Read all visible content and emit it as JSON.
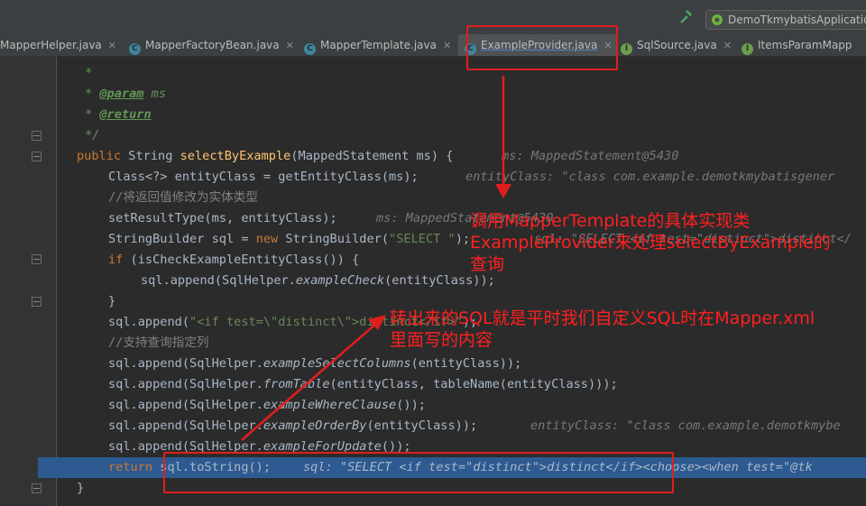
{
  "run_config": "DemoTkmybatisApplication",
  "tabs": [
    {
      "label": "MapperHelper.java",
      "icon": "",
      "active": false
    },
    {
      "label": "MapperFactoryBean.java",
      "icon": "C",
      "active": false
    },
    {
      "label": "MapperTemplate.java",
      "icon": "C",
      "active": false
    },
    {
      "label": "ExampleProvider.java",
      "icon": "C",
      "active": true
    },
    {
      "label": "SqlSource.java",
      "icon": "I",
      "active": false
    },
    {
      "label": "ItemsParamMapp",
      "icon": "I",
      "active": false
    }
  ],
  "code": {
    "doc_star": "*",
    "doc_param_tag": "@param",
    "doc_param_name": "ms",
    "doc_return_tag": "@return",
    "doc_end": "*/",
    "l_sig_kw": "public",
    "l_sig_type": "String",
    "l_sig_fn": "selectByExample",
    "l_sig_args": "(MappedStatement ms) {",
    "l_sig_hint": "ms: MappedStatement@5430",
    "l_class": "Class<?> entityClass = getEntityClass(ms);",
    "l_class_hint": "entityClass: \"class com.example.demotkmybatisgener",
    "l_comment1": "//将返回值修改为实体类型",
    "l_setresult": "setResultType(ms, entityClass);",
    "l_setresult_hint": "ms: MappedStatement@5430",
    "l_sb_a": "StringBuilder sql = ",
    "l_sb_new": "new",
    "l_sb_b": " StringBuilder(",
    "l_sb_str": "\"SELECT \"",
    "l_sb_c": ");",
    "l_sb_hint": "sql: \"SELECT <if test=\"distinct\">distinct</",
    "l_if_kw": "if",
    "l_if": " (isCheckExampleEntityClass()) {",
    "l_append_check_a": "sql.append(SqlHelper.",
    "l_append_check_fn": "exampleCheck",
    "l_append_check_b": "(entityClass));",
    "l_close": "}",
    "l_append_if_a": "sql.append(",
    "l_append_if_str": "\"<if test=\\\"distinct\\\">distinct</if>\"",
    "l_append_if_b": ");",
    "l_comment2": "//支持查询指定列",
    "l_sel_a": "sql.append(SqlHelper.",
    "l_sel_fn": "exampleSelectColumns",
    "l_sel_b": "(entityClass));",
    "l_from_a": "sql.append(SqlHelper.",
    "l_from_fn": "fromTable",
    "l_from_b": "(entityClass, tableName(entityClass)));",
    "l_where_a": "sql.append(SqlHelper.",
    "l_where_fn": "exampleWhereClause",
    "l_where_b": "());",
    "l_order_a": "sql.append(SqlHelper.",
    "l_order_fn": "exampleOrderBy",
    "l_order_b": "(entityClass));",
    "l_order_hint": "entityClass: \"class com.example.demotkmybe",
    "l_upd_a": "sql.append(SqlHelper.",
    "l_upd_fn": "exampleForUpdate",
    "l_upd_b": "());",
    "l_ret_kw": "return",
    "l_ret": " sql.toString();",
    "l_ret_hint": "sql: \"SELECT <if test=\"distinct\">distinct</if><choose><when test=\"@tk",
    "l_end": "}"
  },
  "annotations": {
    "note1": [
      "调用MapperTemplate的具体实现类",
      "ExampleProvider来处理selectByExample的",
      "查询"
    ],
    "note2": [
      "转出来的SQL就是平时我们自定义SQL时在Mapper.xml",
      "里面写的内容"
    ]
  },
  "colors": {
    "annotation_red": "#e01e1e",
    "keyword": "#cc7832",
    "method": "#ffc66d",
    "string": "#6a8759",
    "highlight_line": "#2d5a91"
  }
}
